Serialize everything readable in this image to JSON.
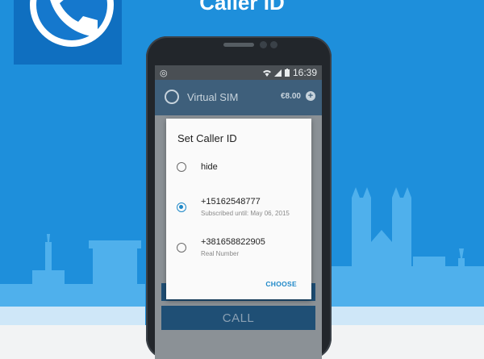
{
  "promo": {
    "title": "Caller ID"
  },
  "status_bar": {
    "time": "16:39"
  },
  "app_bar": {
    "title": "Virtual SIM",
    "balance": "€8.00"
  },
  "dialog": {
    "title": "Set Caller ID",
    "options": [
      {
        "label": "hide",
        "sub": "",
        "selected": false
      },
      {
        "label": "+15162548777",
        "sub": "Subscribed until: May 06, 2015",
        "selected": true
      },
      {
        "label": "+381658822905",
        "sub": "Real Number",
        "selected": false
      }
    ],
    "confirm_label": "CHOOSE"
  },
  "call_button": {
    "label": "CALL"
  },
  "colors": {
    "background": "#1e8fdb",
    "accent": "#1e88c8",
    "logo": "#0f6fc0"
  }
}
